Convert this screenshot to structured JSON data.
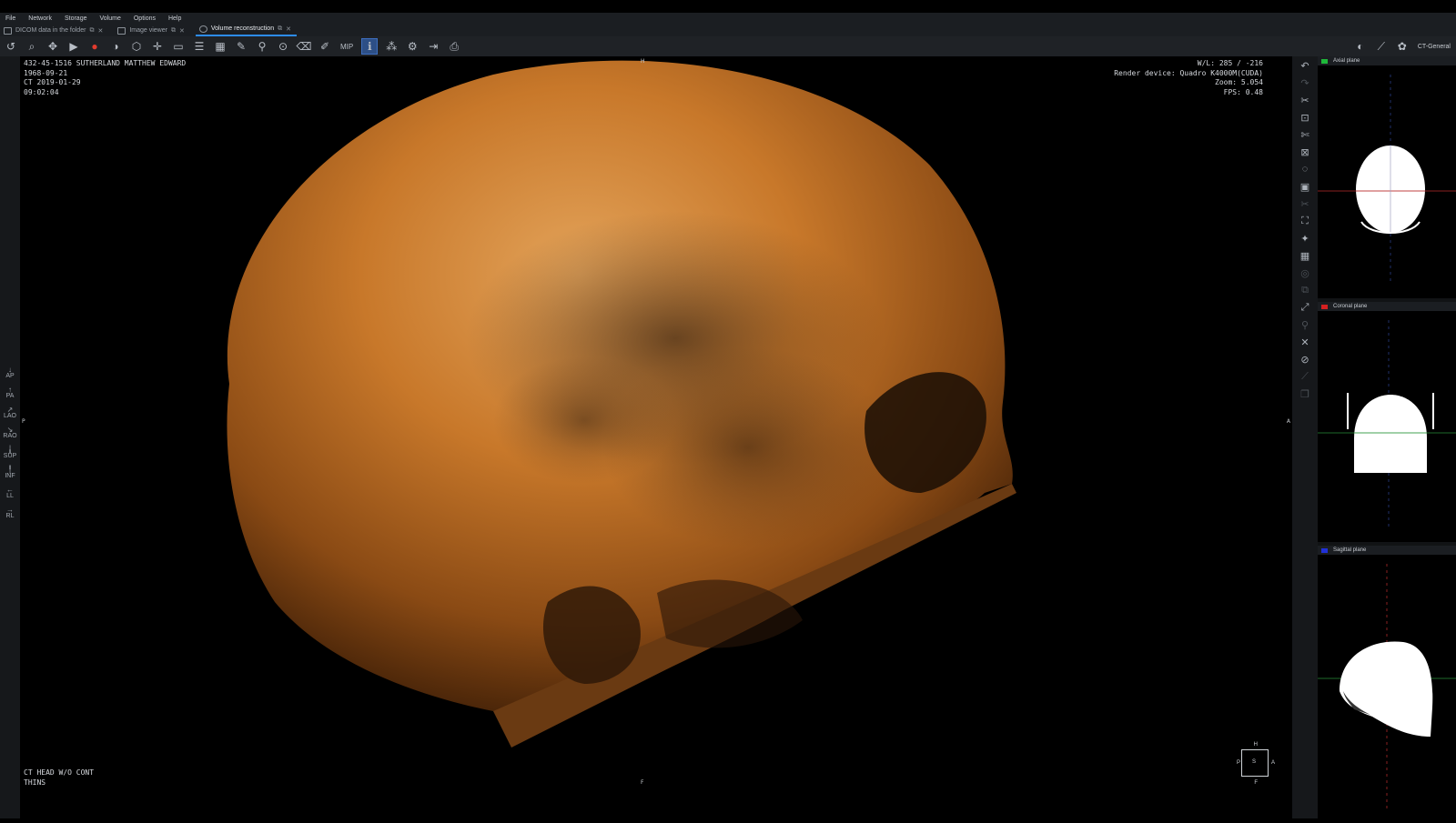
{
  "menu": [
    "File",
    "Network",
    "Storage",
    "Volume",
    "Options",
    "Help"
  ],
  "tabs": [
    {
      "label": "DICOM data in the folder",
      "active": false
    },
    {
      "label": "Image viewer",
      "active": false
    },
    {
      "label": "Volume reconstruction",
      "active": true
    }
  ],
  "toolbar": {
    "mip_label": "MIP",
    "preset": "CT-General"
  },
  "overlay": {
    "patient_id_name": "432-45-1516 SUTHERLAND MATTHEW EDWARD",
    "birth_date": "1968-09-21",
    "study": "CT 2019-01-29",
    "time": "09:02:04",
    "wl": "W/L: 285 / -216",
    "render_device": "Render device: Quadro K4000M(CUDA)",
    "zoom": "Zoom: 5.054",
    "fps": "FPS: 0.48",
    "series_desc": "CT HEAD W/O CONT",
    "series_sub": "THINS"
  },
  "viewport_markers": {
    "top": "H",
    "bottom": "F",
    "left": "P",
    "right": "A"
  },
  "orient_cube": {
    "top": "H",
    "bottom": "F",
    "left": "P",
    "right": "A",
    "center": "S"
  },
  "orientation_buttons": [
    "AP",
    "PA",
    "LAO",
    "RAO",
    "SUP",
    "INF",
    "LL",
    "RL"
  ],
  "planes": [
    {
      "label": "Axial plane",
      "color": "#1fb83a"
    },
    {
      "label": "Coronal plane",
      "color": "#d42020"
    },
    {
      "label": "Sagittal plane",
      "color": "#2030d8"
    }
  ],
  "colors": {
    "bone": "#c8782a",
    "accent": "#2d8cf0"
  }
}
